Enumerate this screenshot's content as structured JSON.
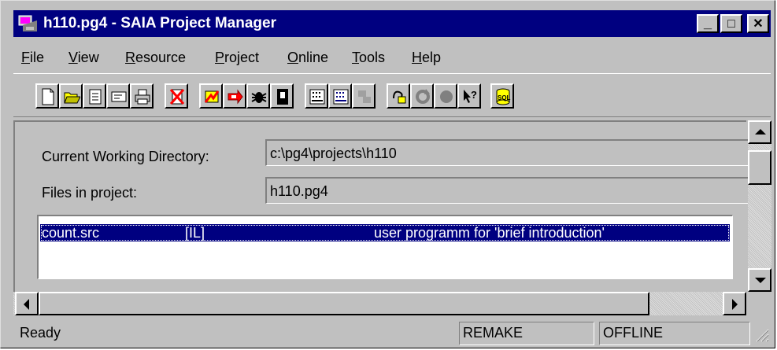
{
  "window": {
    "title": "h110.pg4 - SAIA Project Manager",
    "controls": {
      "minimize": "_",
      "maximize": "□",
      "close": "✕"
    }
  },
  "menu": {
    "file": {
      "label": "File",
      "mnemonic": "F",
      "rest": "ile"
    },
    "view": {
      "label": "View",
      "mnemonic": "V",
      "rest": "iew"
    },
    "resource": {
      "label": "Resource",
      "mnemonic": "R",
      "rest": "esource"
    },
    "project": {
      "label": "Project",
      "mnemonic": "P",
      "rest": "roject"
    },
    "online": {
      "label": "Online",
      "mnemonic": "O",
      "rest": "nline"
    },
    "tools": {
      "label": "Tools",
      "mnemonic": "T",
      "rest": "ools"
    },
    "help": {
      "label": "Help",
      "mnemonic": "H",
      "rest": "elp"
    }
  },
  "toolbar": {
    "buttons": [
      "new-file-icon",
      "open-folder-icon",
      "document-icon",
      "message-icon",
      "print-icon",
      "delete-icon",
      "build-icon",
      "link-icon",
      "debug-icon",
      "online-icon",
      "grid-editor-icon",
      "fupla-icon",
      "transfer-icon",
      "blocks-icon",
      "refresh-icon",
      "stop-icon",
      "help-pointer-icon",
      "sql-icon"
    ],
    "sql_label": "SQL"
  },
  "fields": {
    "cwd_label": "Current Working Directory:",
    "cwd_value": "c:\\pg4\\projects\\h110",
    "files_label": "Files in project:",
    "files_value": "h110.pg4"
  },
  "files": [
    {
      "name": "count.src",
      "type": "[IL]",
      "description": "user programm for 'brief introduction'"
    }
  ],
  "status": {
    "text": "Ready",
    "remake": "REMAKE",
    "online": "OFFLINE"
  },
  "colors": {
    "titlebar": "#000080",
    "selection": "#000080",
    "face": "#c0c0c0"
  }
}
